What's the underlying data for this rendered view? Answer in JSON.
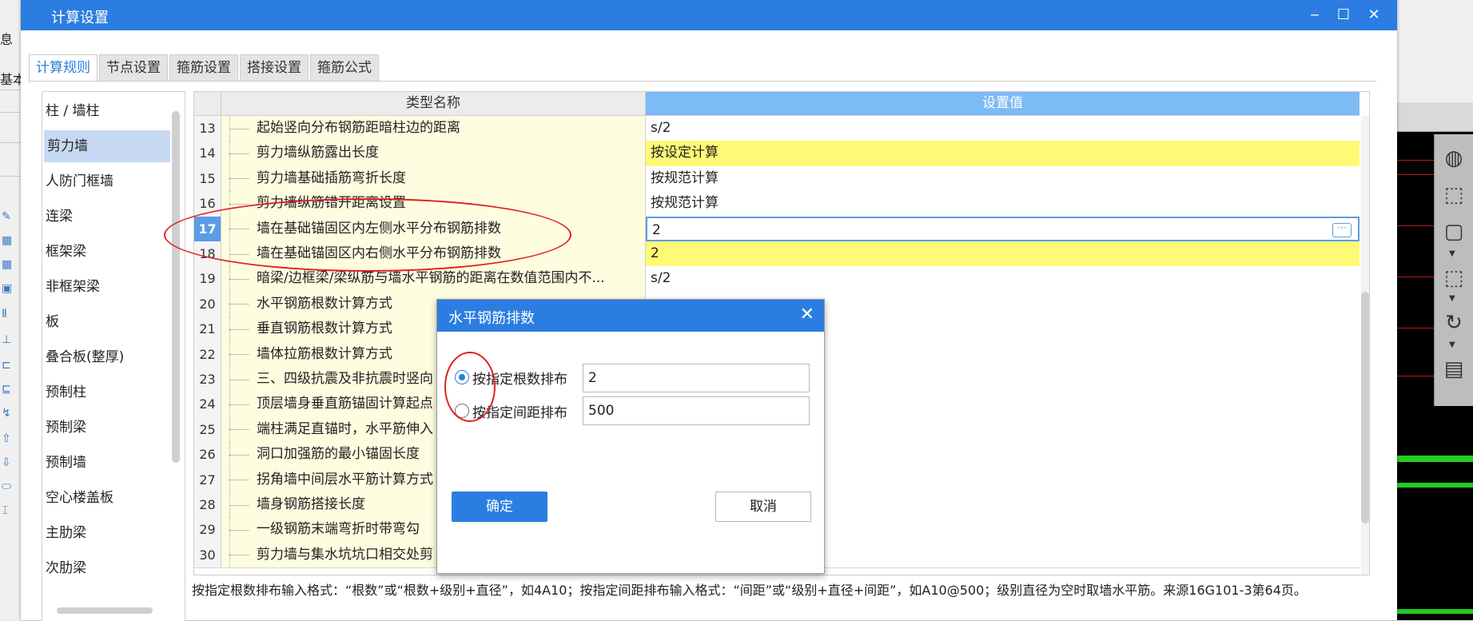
{
  "background_left": {
    "labels": [
      "息",
      "基本"
    ]
  },
  "window": {
    "title": "计算设置",
    "minimize_glyph": "‒",
    "maximize_glyph": "☐",
    "close_glyph": "✕"
  },
  "tabs": [
    "计算规则",
    "节点设置",
    "箍筋设置",
    "搭接设置",
    "箍筋公式"
  ],
  "categories": [
    "柱 / 墙柱",
    "剪力墙",
    "人防门框墙",
    "连梁",
    "框架梁",
    "非框架梁",
    "板",
    "叠合板(整厚)",
    "预制柱",
    "预制梁",
    "预制墙",
    "空心楼盖板",
    "主肋梁",
    "次肋梁"
  ],
  "grid": {
    "header_name": "类型名称",
    "header_value": "设置值",
    "rows": [
      {
        "num": "13",
        "name": "起始竖向分布钢筋距暗柱边的距离",
        "value": "s/2"
      },
      {
        "num": "14",
        "name": "剪力墙纵筋露出长度",
        "value": "按设定计算"
      },
      {
        "num": "15",
        "name": "剪力墙基础插筋弯折长度",
        "value": "按规范计算"
      },
      {
        "num": "16",
        "name": "剪力墙纵筋错开距离设置",
        "value": "按规范计算"
      },
      {
        "num": "17",
        "name": "墙在基础锚固区内左侧水平分布钢筋排数",
        "value": "2"
      },
      {
        "num": "18",
        "name": "墙在基础锚固区内右侧水平分布钢筋排数",
        "value": "2"
      },
      {
        "num": "19",
        "name": "暗梁/边框梁/梁纵筋与墙水平钢筋的距离在数值范围内不...",
        "value": "s/2"
      },
      {
        "num": "20",
        "name": "水平钢筋根数计算方式",
        "value": ""
      },
      {
        "num": "21",
        "name": "垂直钢筋根数计算方式",
        "value": ""
      },
      {
        "num": "22",
        "name": "墙体拉筋根数计算方式",
        "value": ""
      },
      {
        "num": "23",
        "name": "三、四级抗震及非抗震时竖向",
        "value": ""
      },
      {
        "num": "24",
        "name": "顶层墙身垂直筋锚固计算起点",
        "value": ""
      },
      {
        "num": "25",
        "name": "端柱满足直锚时，水平筋伸入",
        "value": ""
      },
      {
        "num": "26",
        "name": "洞口加强筋的最小锚固长度",
        "value": ""
      },
      {
        "num": "27",
        "name": "拐角墙中间层水平筋计算方式",
        "value": ""
      },
      {
        "num": "28",
        "name": "墙身钢筋搭接长度",
        "value": ""
      },
      {
        "num": "29",
        "name": "一级钢筋末端弯折时带弯勾",
        "value": ""
      },
      {
        "num": "30",
        "name": "剪力墙与集水坑坑口相交处剪",
        "value": ""
      }
    ],
    "selected_row": "17",
    "highlight_rows": [
      "14",
      "18"
    ],
    "edit_button_glyph": "···"
  },
  "hint": "按指定根数排布输入格式：“根数”或“根数+级别+直径”，如4A10；按指定间距排布输入格式：“间距”或“级别+直径+间距”，如A10@500；级别直径为空时取墙水平筋。来源16G101-3第64页。",
  "dialog": {
    "title": "水平钢筋排数",
    "close_glyph": "✕",
    "option1_label": "按指定根数排布",
    "option1_value": "2",
    "option2_label": "按指定间距排布",
    "option2_value": "500",
    "selected_option": "option1",
    "ok_label": "确定",
    "cancel_label": "取消"
  },
  "colors": {
    "accent": "#2b7de1",
    "header_value_bg": "#7dbbf5",
    "highlight_yellow": "#fff977",
    "name_cell_bg": "#fffde0",
    "annotation_red": "#e02020"
  }
}
